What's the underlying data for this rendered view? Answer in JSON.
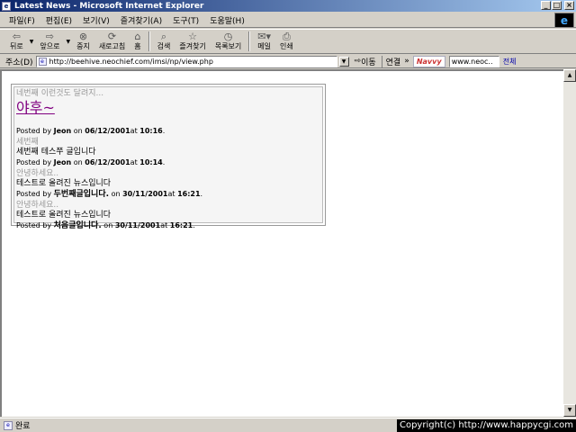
{
  "window": {
    "title": "Latest News - Microsoft Internet Explorer"
  },
  "menu": [
    "파일(F)",
    "편집(E)",
    "보기(V)",
    "즐겨찾기(A)",
    "도구(T)",
    "도움말(H)"
  ],
  "toolbar": {
    "back": "뒤로",
    "forward": "앞으로",
    "stop": "중지",
    "refresh": "새로고침",
    "home": "홈",
    "search": "검색",
    "favorites": "즐겨찾기",
    "history": "목록보기",
    "mail": "메일",
    "print": "인쇄"
  },
  "address": {
    "label": "주소(D)",
    "url": "http://beehive.neochief.com/imsi/np/view.php",
    "go": "이동",
    "links": "연결",
    "links_more": "»",
    "navvy": "Navvy",
    "search_value": "www.neoc..",
    "search_all": "전체"
  },
  "news": [
    {
      "title": "네번째 이런것도 달려지...",
      "body": "",
      "posted_prefix": "Posted by",
      "author": "",
      "on": "",
      "date": "",
      "at": "",
      "time": ""
    },
    {
      "title": "야후~",
      "body": "",
      "posted_prefix": "Posted by",
      "author": "Jeon",
      "on": "on",
      "date": "06/12/2001",
      "at": "at",
      "time": "10:16"
    },
    {
      "title": "세번째",
      "body": "세번째 테스쭈 글입니다",
      "posted_prefix": "Posted by",
      "author": "Jeon",
      "on": "on",
      "date": "06/12/2001",
      "at": "at",
      "time": "10:14"
    },
    {
      "title": "안녕하세요..",
      "body": "테스트로 올려진 뉴스입니다",
      "posted_prefix": "Posted by",
      "author": "두번째글입니다.",
      "on": "on",
      "date": "30/11/2001",
      "at": "at",
      "time": "16:21"
    },
    {
      "title": "안녕하세요..",
      "body": "테스트로 올려진 뉴스입니다",
      "posted_prefix": "Posted by",
      "author": "처음글입니다.",
      "on": "on",
      "date": "30/11/2001",
      "at": "at",
      "time": "16:21"
    }
  ],
  "status": {
    "text": "완료",
    "copyright": "Copyright(c) http://www.happycgi.com"
  }
}
